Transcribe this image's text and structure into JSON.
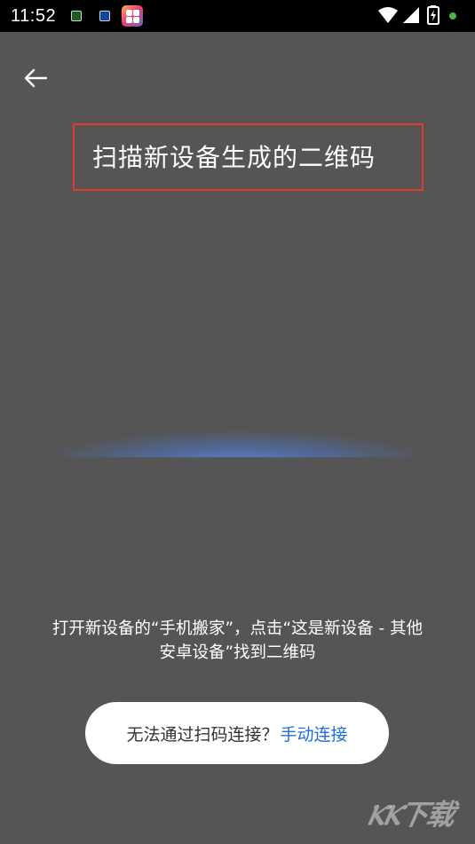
{
  "status_bar": {
    "time": "11:52",
    "icons": [
      "notification-icon",
      "notification-icon",
      "app-icon",
      "wifi-icon",
      "signal-icon",
      "battery-charging-icon",
      "notification-dot-icon"
    ]
  },
  "header": {
    "back_icon": "arrow-left-icon"
  },
  "scan": {
    "title": "扫描新设备生成的二维码",
    "instruction_line1": "打开新设备的“手机搬家”，点击“这是新设备 - 其他",
    "instruction_line2": "安卓设备”找到二维码"
  },
  "manual_connect": {
    "prompt": "无法通过扫码连接？",
    "link": "手动连接"
  },
  "colors": {
    "background": "#555555",
    "status_bar": "#000000",
    "highlight_border": "#e53935",
    "link": "#1e6fd9",
    "scan_glow": "#5c88e0"
  }
}
